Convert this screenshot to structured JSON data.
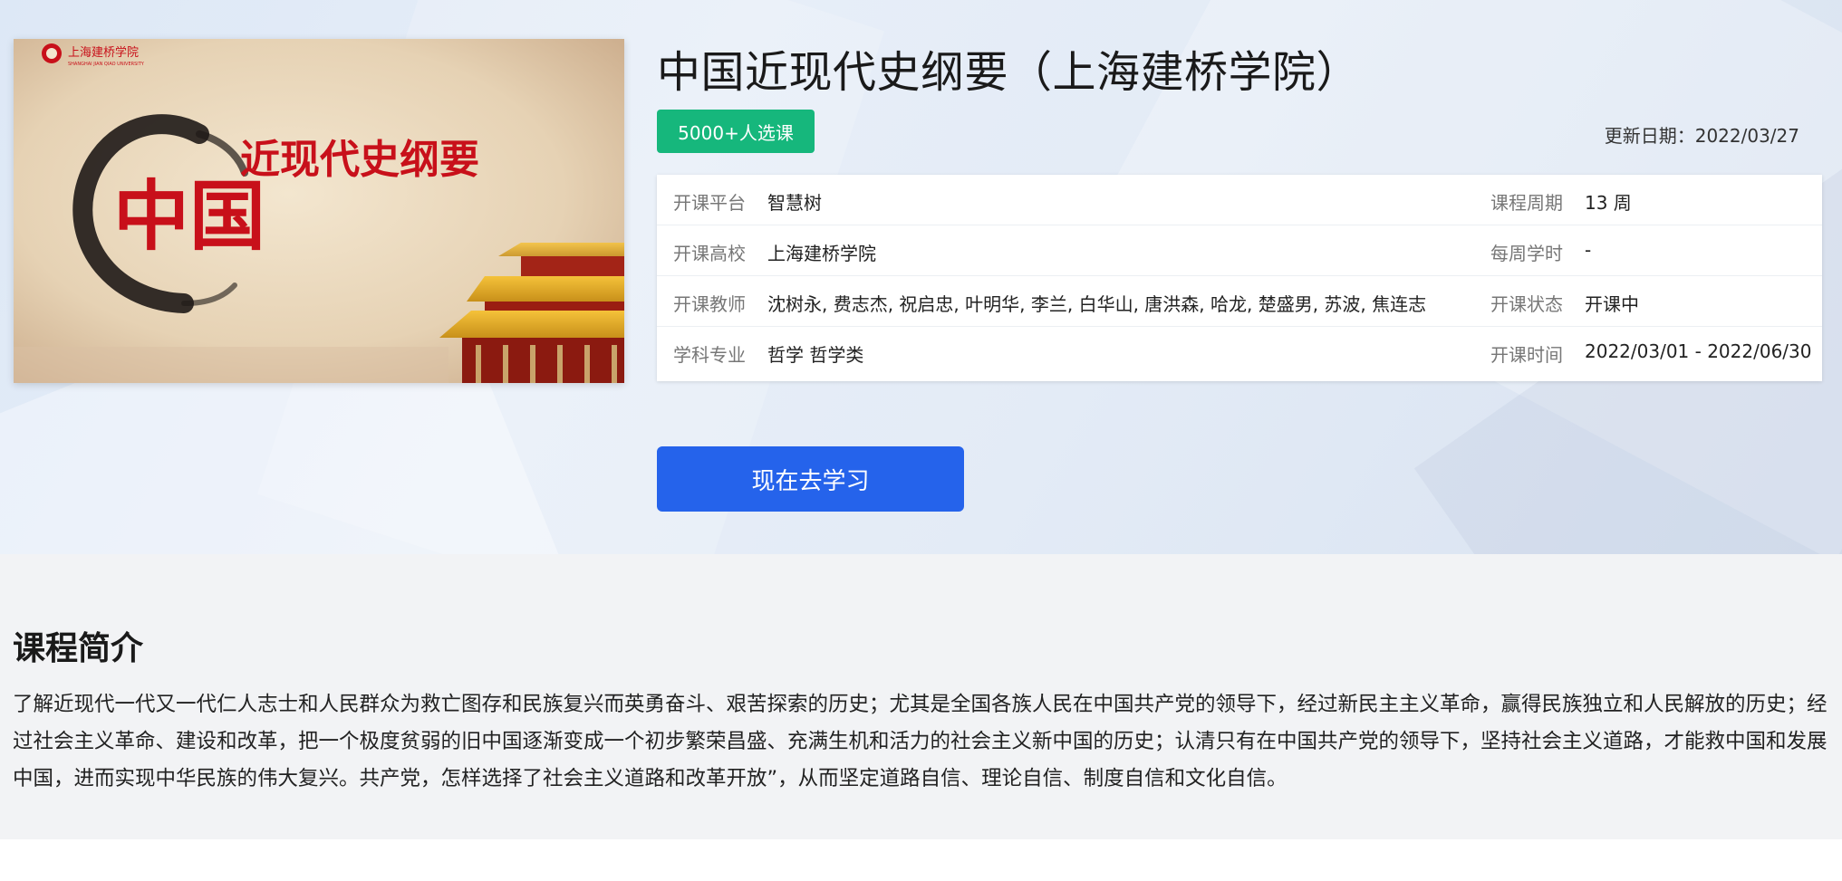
{
  "course": {
    "title": "中国近现代史纲要（上海建桥学院）",
    "enroll_badge": "5000+人选课",
    "update_date": "更新日期：2022/03/27",
    "cover": {
      "school_logo_text": "上海建桥学院",
      "school_logo_subtext": "SHANGHAI JIAN QIAO UNIVERSITY",
      "calligraphy_main": "中国",
      "calligraphy_sub": "近现代史纲要"
    }
  },
  "info": {
    "rows": [
      {
        "k1": "开课平台",
        "v1": "智慧树",
        "k2": "课程周期",
        "v2": "13 周"
      },
      {
        "k1": "开课高校",
        "v1": "上海建桥学院",
        "k2": "每周学时",
        "v2": "-"
      },
      {
        "k1": "开课教师",
        "v1": "沈树永, 费志杰, 祝启忠, 叶明华, 李兰, 白华山, 唐洪森, 哈龙, 楚盛男, 苏波, 焦连志",
        "k2": "开课状态",
        "v2": "开课中"
      },
      {
        "k1": "学科专业",
        "v1": "哲学 哲学类",
        "k2": "开课时间",
        "v2": "2022/03/01 - 2022/06/30"
      }
    ]
  },
  "actions": {
    "study_label": "现在去学习"
  },
  "intro": {
    "title": "课程简介",
    "text": "了解近现代一代又一代仁人志士和人民群众为救亡图存和民族复兴而英勇奋斗、艰苦探索的历史；尤其是全国各族人民在中国共产党的领导下，经过新民主主义革命，赢得民族独立和人民解放的历史；经过社会主义革命、建设和改革，把一个极度贫弱的旧中国逐渐变成一个初步繁荣昌盛、充满生机和活力的社会主义新中国的历史；认清只有在中国共产党的领导下，坚持社会主义道路，才能救中国和发展中国，进而实现中华民族的伟大复兴。共产党，怎样选择了社会主义道路和改革开放”，从而坚定道路自信、理论自信、制度自信和文化自信。"
  },
  "colors": {
    "accent_green": "#16b77c",
    "primary_blue": "#2563eb",
    "calligraphy_red": "#c8101a"
  }
}
